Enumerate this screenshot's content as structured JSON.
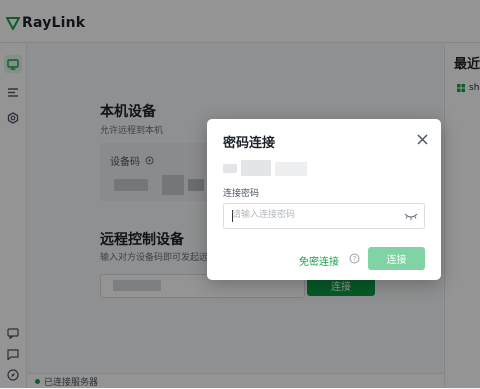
{
  "app": {
    "brand": "RayLink"
  },
  "main": {
    "local": {
      "title": "本机设备",
      "subtitle": "允许远程到本机",
      "device_code_label": "设备码"
    },
    "remote": {
      "title": "远程控制设备",
      "subtitle": "输入对方设备码即可发起远程控制",
      "connect_label": "连接"
    }
  },
  "recent": {
    "title": "最近",
    "item_label": "sh"
  },
  "status": {
    "text": "已连接服务器"
  },
  "dialog": {
    "title": "密码连接",
    "password_label": "连接密码",
    "password_placeholder": "请输入连接密码",
    "password_value": "",
    "no_password_label": "免密连接",
    "connect_label": "连接"
  },
  "colors": {
    "accent": "#0c9c44",
    "accent_disabled": "#7fd3a5",
    "text_primary": "#1d2129"
  },
  "icons": {
    "rail": [
      "monitor-icon",
      "list-icon",
      "settings-icon",
      "message-icon",
      "feedback-icon",
      "compass-icon"
    ],
    "dialog": [
      "close-icon",
      "eye-closed-icon",
      "help-icon"
    ]
  }
}
